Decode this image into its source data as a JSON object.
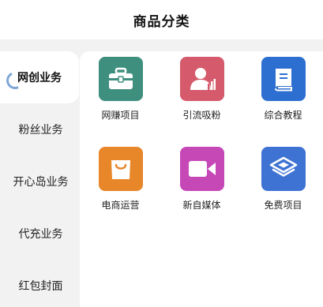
{
  "header": {
    "title": "商品分类"
  },
  "sidebar": {
    "items": [
      {
        "label": "网创业务",
        "active": true
      },
      {
        "label": "粉丝业务",
        "active": false
      },
      {
        "label": "开心岛业务",
        "active": false
      },
      {
        "label": "代充业务",
        "active": false
      },
      {
        "label": "红包封面",
        "active": false
      }
    ]
  },
  "grid": {
    "items": [
      {
        "label": "网赚项目",
        "icon": "briefcase-icon",
        "color": "#3f8f7f"
      },
      {
        "label": "引流吸粉",
        "icon": "person-chart-icon",
        "color": "#d55a6c"
      },
      {
        "label": "综合教程",
        "icon": "book-icon",
        "color": "#2c6fd1"
      },
      {
        "label": "电商运营",
        "icon": "shopping-bag-icon",
        "color": "#e8862a"
      },
      {
        "label": "新自媒体",
        "icon": "video-camera-icon",
        "color": "#c548b6"
      },
      {
        "label": "免费项目",
        "icon": "layers-icon",
        "color": "#3f73d3"
      }
    ]
  }
}
